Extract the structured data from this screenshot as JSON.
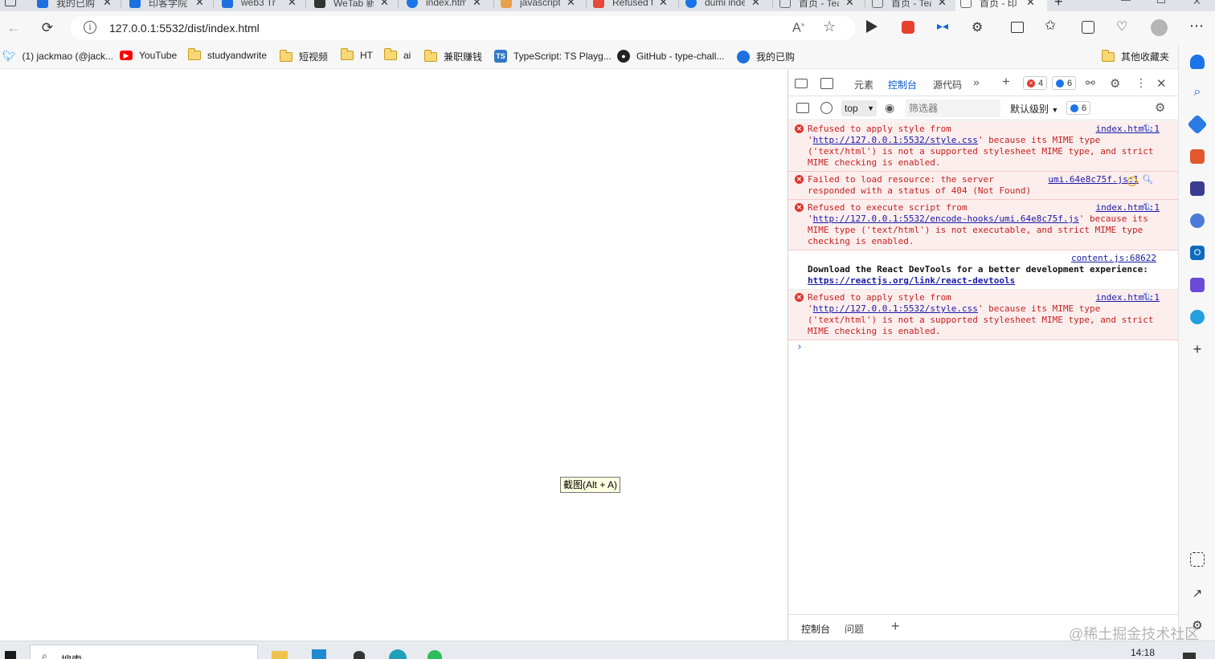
{
  "tabs": [
    {
      "label": "我的已购",
      "color": "#1e6fe0"
    },
    {
      "label": "印客学院",
      "color": "#1e6fe0"
    },
    {
      "label": "web3 Tr",
      "color": "#1e6fe0"
    },
    {
      "label": "WeTab 新",
      "color": "#333333"
    },
    {
      "label": "index.htm",
      "color": "#1a73e8"
    },
    {
      "label": "javascript",
      "color": "#e8a04a"
    },
    {
      "label": "Refused t",
      "color": "#e34a3b"
    },
    {
      "label": "dumi index",
      "color": "#1a73e8"
    },
    {
      "label": "首页 - Tea",
      "color": "#666666"
    },
    {
      "label": "首页 - Tea",
      "color": "#666666"
    },
    {
      "label": "首页 - 印",
      "color": "#666666",
      "active": true
    }
  ],
  "address": {
    "url": "127.0.0.1:5532/dist/index.html"
  },
  "bookmarks": [
    {
      "label": "(1) jackmao (@jack...",
      "type": "twitter"
    },
    {
      "label": "YouTube",
      "type": "youtube"
    },
    {
      "label": "studyandwrite",
      "type": "folder"
    },
    {
      "label": "短视频",
      "type": "folder"
    },
    {
      "label": "HT",
      "type": "folder"
    },
    {
      "label": "ai",
      "type": "folder"
    },
    {
      "label": "兼职赚钱",
      "type": "folder"
    },
    {
      "label": "TypeScript: TS Playg...",
      "type": "ts"
    },
    {
      "label": "GitHub - type-chall...",
      "type": "github"
    },
    {
      "label": "我的已购",
      "type": "site"
    }
  ],
  "bookmarks_other": "其他收藏夹",
  "tooltip": "截图(Alt + A)",
  "devtools": {
    "tabs": [
      "元素",
      "控制台",
      "源代码"
    ],
    "active_tab": "控制台",
    "error_count": "4",
    "info_count": "6",
    "context": "top",
    "filter_placeholder": "筛选器",
    "level": "默认级别",
    "level_count": "6",
    "messages": [
      {
        "level": "error",
        "source": "index.html:1",
        "parts": [
          "Refused to apply style from '",
          "http://127.0.0.1:5532/style.css",
          "' because its MIME type ('text/html') is not a supported stylesheet MIME type, and strict MIME checking is enabled."
        ]
      },
      {
        "level": "error",
        "source": "umi.64e8c75f.js:1",
        "parts": [
          "Failed to load resource: the server responded with a status of 404 (Not Found)",
          "",
          ""
        ]
      },
      {
        "level": "error",
        "source": "index.html:1",
        "parts": [
          "Refused to execute script from '",
          "http://127.0.0.1:5532/encode-hooks/umi.64e8c75f.js",
          "' because its MIME type ('text/html') is not executable, and strict MIME type checking is enabled."
        ]
      },
      {
        "level": "info",
        "source": "content.js:68622",
        "parts": [
          "Download the React DevTools for a better development experience: ",
          "https://reactjs.org/link/react-devtools",
          ""
        ]
      },
      {
        "level": "error",
        "source": "index.html:1",
        "parts": [
          "Refused to apply style from '",
          "http://127.0.0.1:5532/style.css",
          "' because its MIME type ('text/html') is not a supported stylesheet MIME type, and strict MIME checking is enabled."
        ]
      }
    ],
    "drawer_tabs": [
      "控制台",
      "问题"
    ]
  },
  "taskbar": {
    "search": "搜索",
    "time": "14:18"
  },
  "watermark": "@稀土掘金技术社区"
}
